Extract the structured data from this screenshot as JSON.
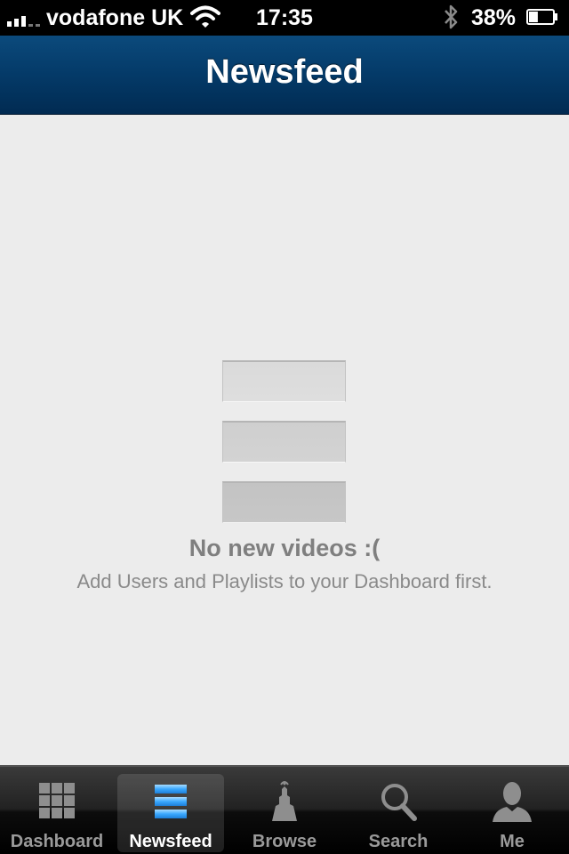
{
  "status_bar": {
    "carrier": "vodafone UK",
    "time": "17:35",
    "battery_percent": "38%",
    "battery_level": 0.38,
    "icons": [
      "signal-icon",
      "wifi-icon",
      "bluetooth-icon",
      "battery-icon"
    ]
  },
  "nav_bar": {
    "title": "Newsfeed",
    "color": "#043a68"
  },
  "empty_state": {
    "title": "No new videos :(",
    "subtitle": "Add Users and Playlists to your Dashboard first.",
    "icon": "newsfeed-placeholder-icon"
  },
  "tab_bar": {
    "active_tab": "Newsfeed",
    "accent_color": "#3aa8ff",
    "tabs": [
      {
        "label": "Dashboard",
        "icon": "grid-icon"
      },
      {
        "label": "Newsfeed",
        "icon": "newsfeed-icon"
      },
      {
        "label": "Browse",
        "icon": "tower-icon"
      },
      {
        "label": "Search",
        "icon": "search-icon"
      },
      {
        "label": "Me",
        "icon": "user-icon"
      }
    ]
  }
}
